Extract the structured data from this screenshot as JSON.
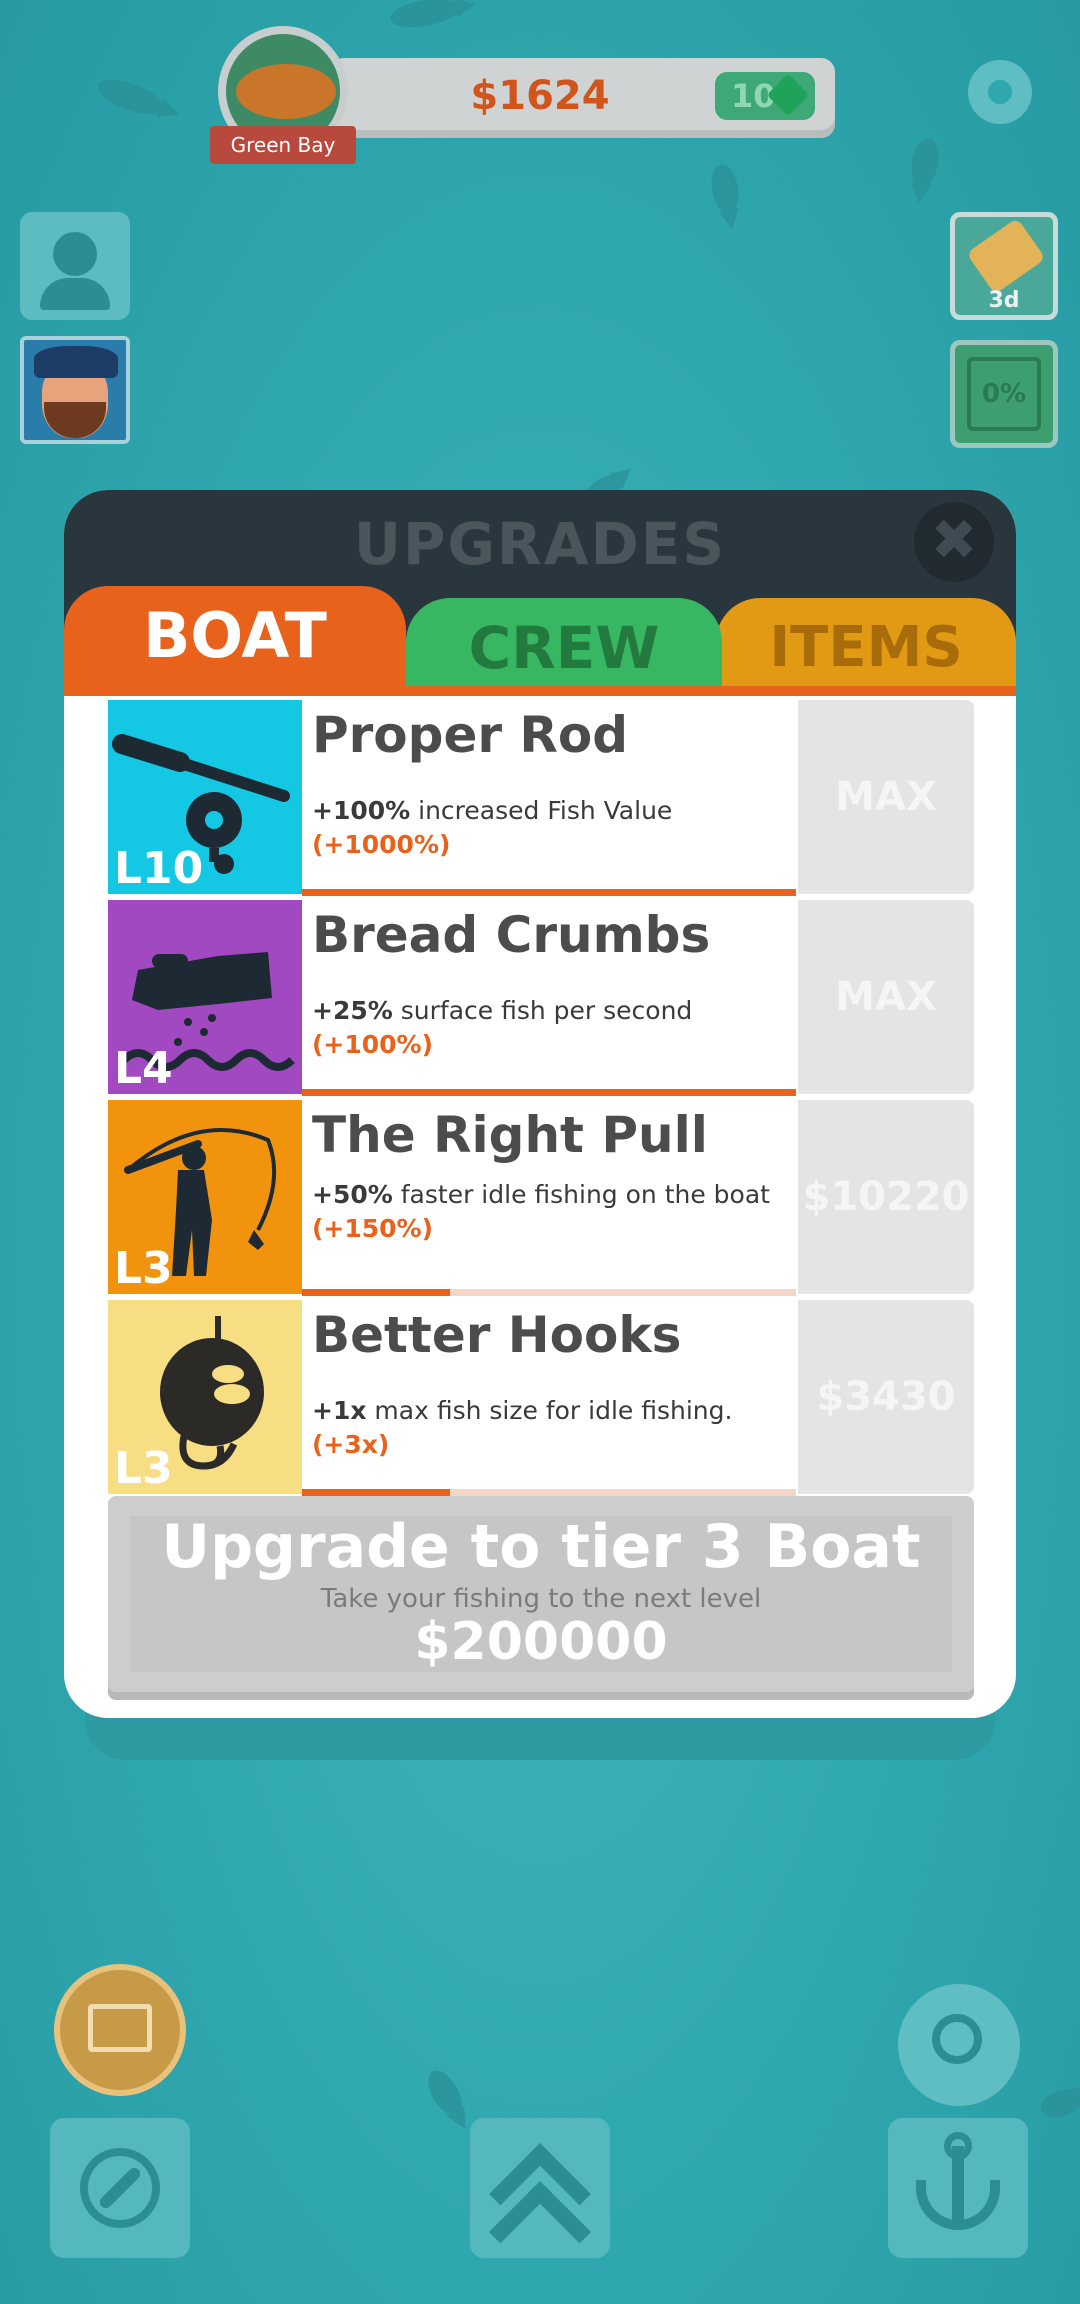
{
  "header": {
    "money": "$1624",
    "gems": "10",
    "location": "Green Bay"
  },
  "side": {
    "scroll_timer": "3d",
    "boost_percent": "0%"
  },
  "panel": {
    "title": "UPGRADES",
    "close_label": "✖",
    "tabs": [
      {
        "label": "BOAT",
        "active": true,
        "color": "#e8621c"
      },
      {
        "label": "CREW",
        "active": false,
        "color": "#37b761"
      },
      {
        "label": "ITEMS",
        "active": false,
        "color": "#e29a15"
      }
    ],
    "upgrades": [
      {
        "name": "Proper Rod",
        "level": "L10",
        "amount": "+100%",
        "desc": "increased Fish Value",
        "bonus": "(+1000%)",
        "price": "MAX",
        "progress": 1.0,
        "icon": "fishing-rod-icon",
        "icon_bg": "#14c7e3"
      },
      {
        "name": "Bread Crumbs",
        "level": "L4",
        "amount": "+25%",
        "desc": "surface fish per second",
        "bonus": "(+100%)",
        "price": "MAX",
        "progress": 1.0,
        "icon": "hand-crumbs-icon",
        "icon_bg": "#a149c0"
      },
      {
        "name": "The Right Pull",
        "level": "L3",
        "amount": "+50%",
        "desc": "faster idle fishing on the boat",
        "bonus": "(+150%)",
        "price": "$10220",
        "progress": 0.3,
        "icon": "fisherman-icon",
        "icon_bg": "#f2930d"
      },
      {
        "name": "Better Hooks",
        "level": "L3",
        "amount": "+1x",
        "desc": "max fish size for idle fishing.",
        "bonus": "(+3x)",
        "price": "$3430",
        "progress": 0.3,
        "icon": "hook-lure-icon",
        "icon_bg": "#f8de83"
      }
    ],
    "tier_upgrade": {
      "title": "Upgrade to tier 3 Boat",
      "subtitle": "Take your fishing to the next level",
      "price": "$200000"
    }
  },
  "colors": {
    "accent": "#e8621c",
    "sea": "#33a9b0",
    "panel_header": "#2a363d"
  }
}
